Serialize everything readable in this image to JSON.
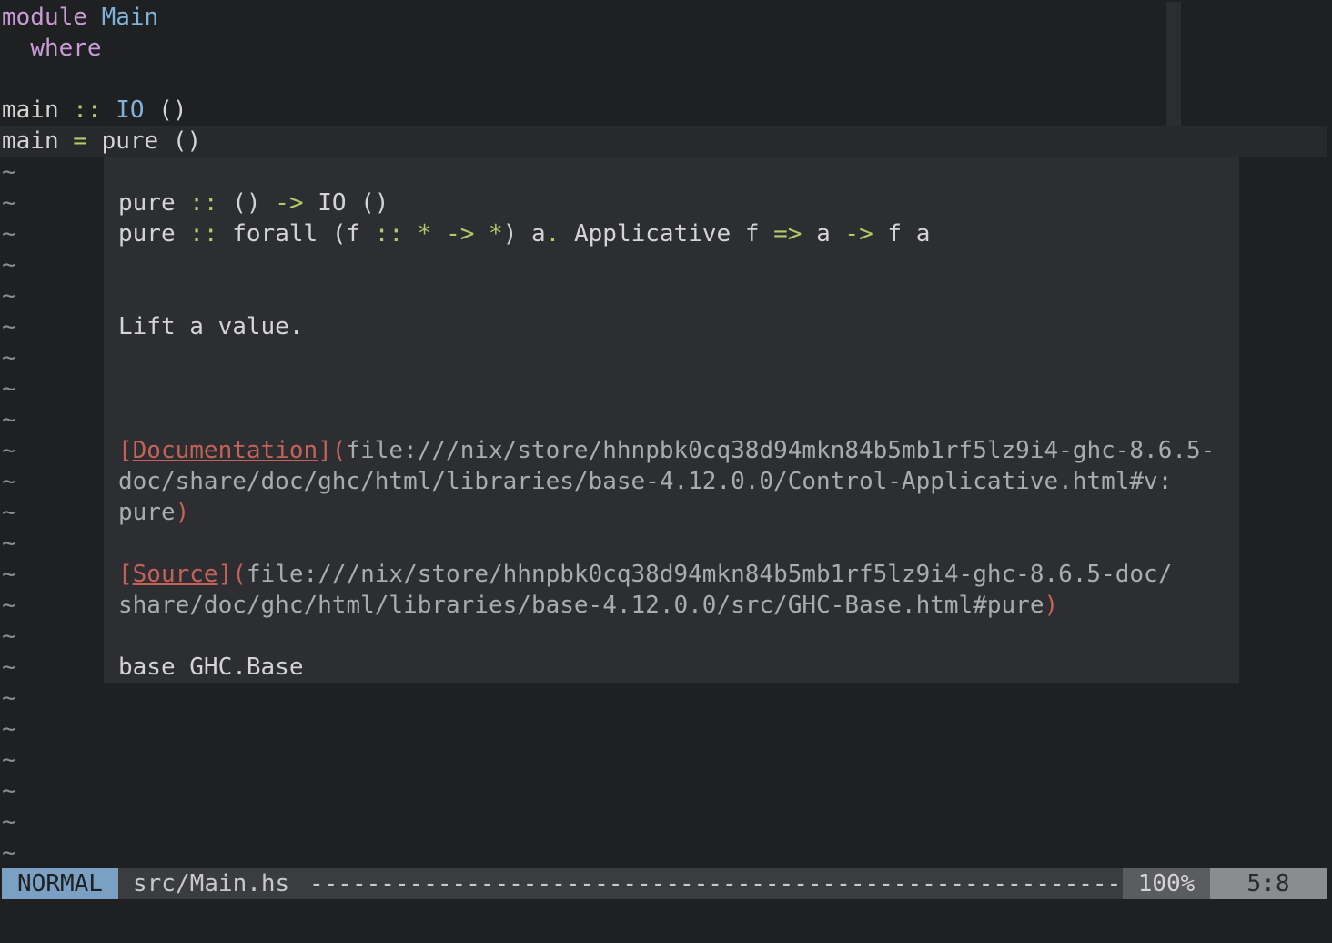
{
  "editor": {
    "line1": {
      "kw": "module",
      "name": "Main"
    },
    "line2": {
      "kw": "where"
    },
    "line4": {
      "name": "main",
      "op": "::",
      "type": "IO",
      "rest": "()"
    },
    "line5": {
      "name": "main",
      "op": "=",
      "fn": "pure",
      "rest": "()"
    },
    "tilde": "~"
  },
  "popup": {
    "sig1": {
      "name": "pure",
      "op1": "::",
      "a": "()",
      "arrow": "->",
      "ty": "IO",
      "b": "()"
    },
    "sig2": {
      "name": "pure",
      "op1": "::",
      "forall": "forall",
      "paren_open": "(f",
      "op2": "::",
      "star1": "*",
      "arrow1": "->",
      "star2": "*",
      "paren_close": ")",
      "a": "a",
      "dot": ".",
      "cls": "Applicative",
      "f1": "f",
      "fat": "=>",
      "a2": "a",
      "arrow2": "->",
      "f2": "f",
      "a3": "a"
    },
    "description": "Lift a value.",
    "doc_link": {
      "open": "[",
      "label": "Documentation",
      "close": "](",
      "url_line1": "file:///nix/store/hhnpbk0cq38d94mkn84b5mb1rf5lz9i4-ghc-8.6.5-",
      "url_line2": "doc/share/doc/ghc/html/libraries/base-4.12.0.0/Control-Applicative.html#v:",
      "url_line3": "pure",
      "end": ")"
    },
    "source_link": {
      "open": "[",
      "label": "Source",
      "close": "](",
      "url_line1": "file:///nix/store/hhnpbk0cq38d94mkn84b5mb1rf5lz9i4-ghc-8.6.5-doc/",
      "url_line2": "share/doc/ghc/html/libraries/base-4.12.0.0/src/GHC-Base.html#pure",
      "end": ")"
    },
    "module": "base GHC.Base"
  },
  "statusline": {
    "mode": "NORMAL",
    "filename": "src/Main.hs",
    "fill": "---------------------------------------------------------",
    "percent": "100%",
    "position": "5:8"
  },
  "colors": {
    "background": "#1f2022",
    "keyword": "#c99bd6",
    "type": "#7fb1d9",
    "operator": "#b5c96a",
    "link": "#c4625a",
    "mode_bg": "#7aa0c4"
  }
}
